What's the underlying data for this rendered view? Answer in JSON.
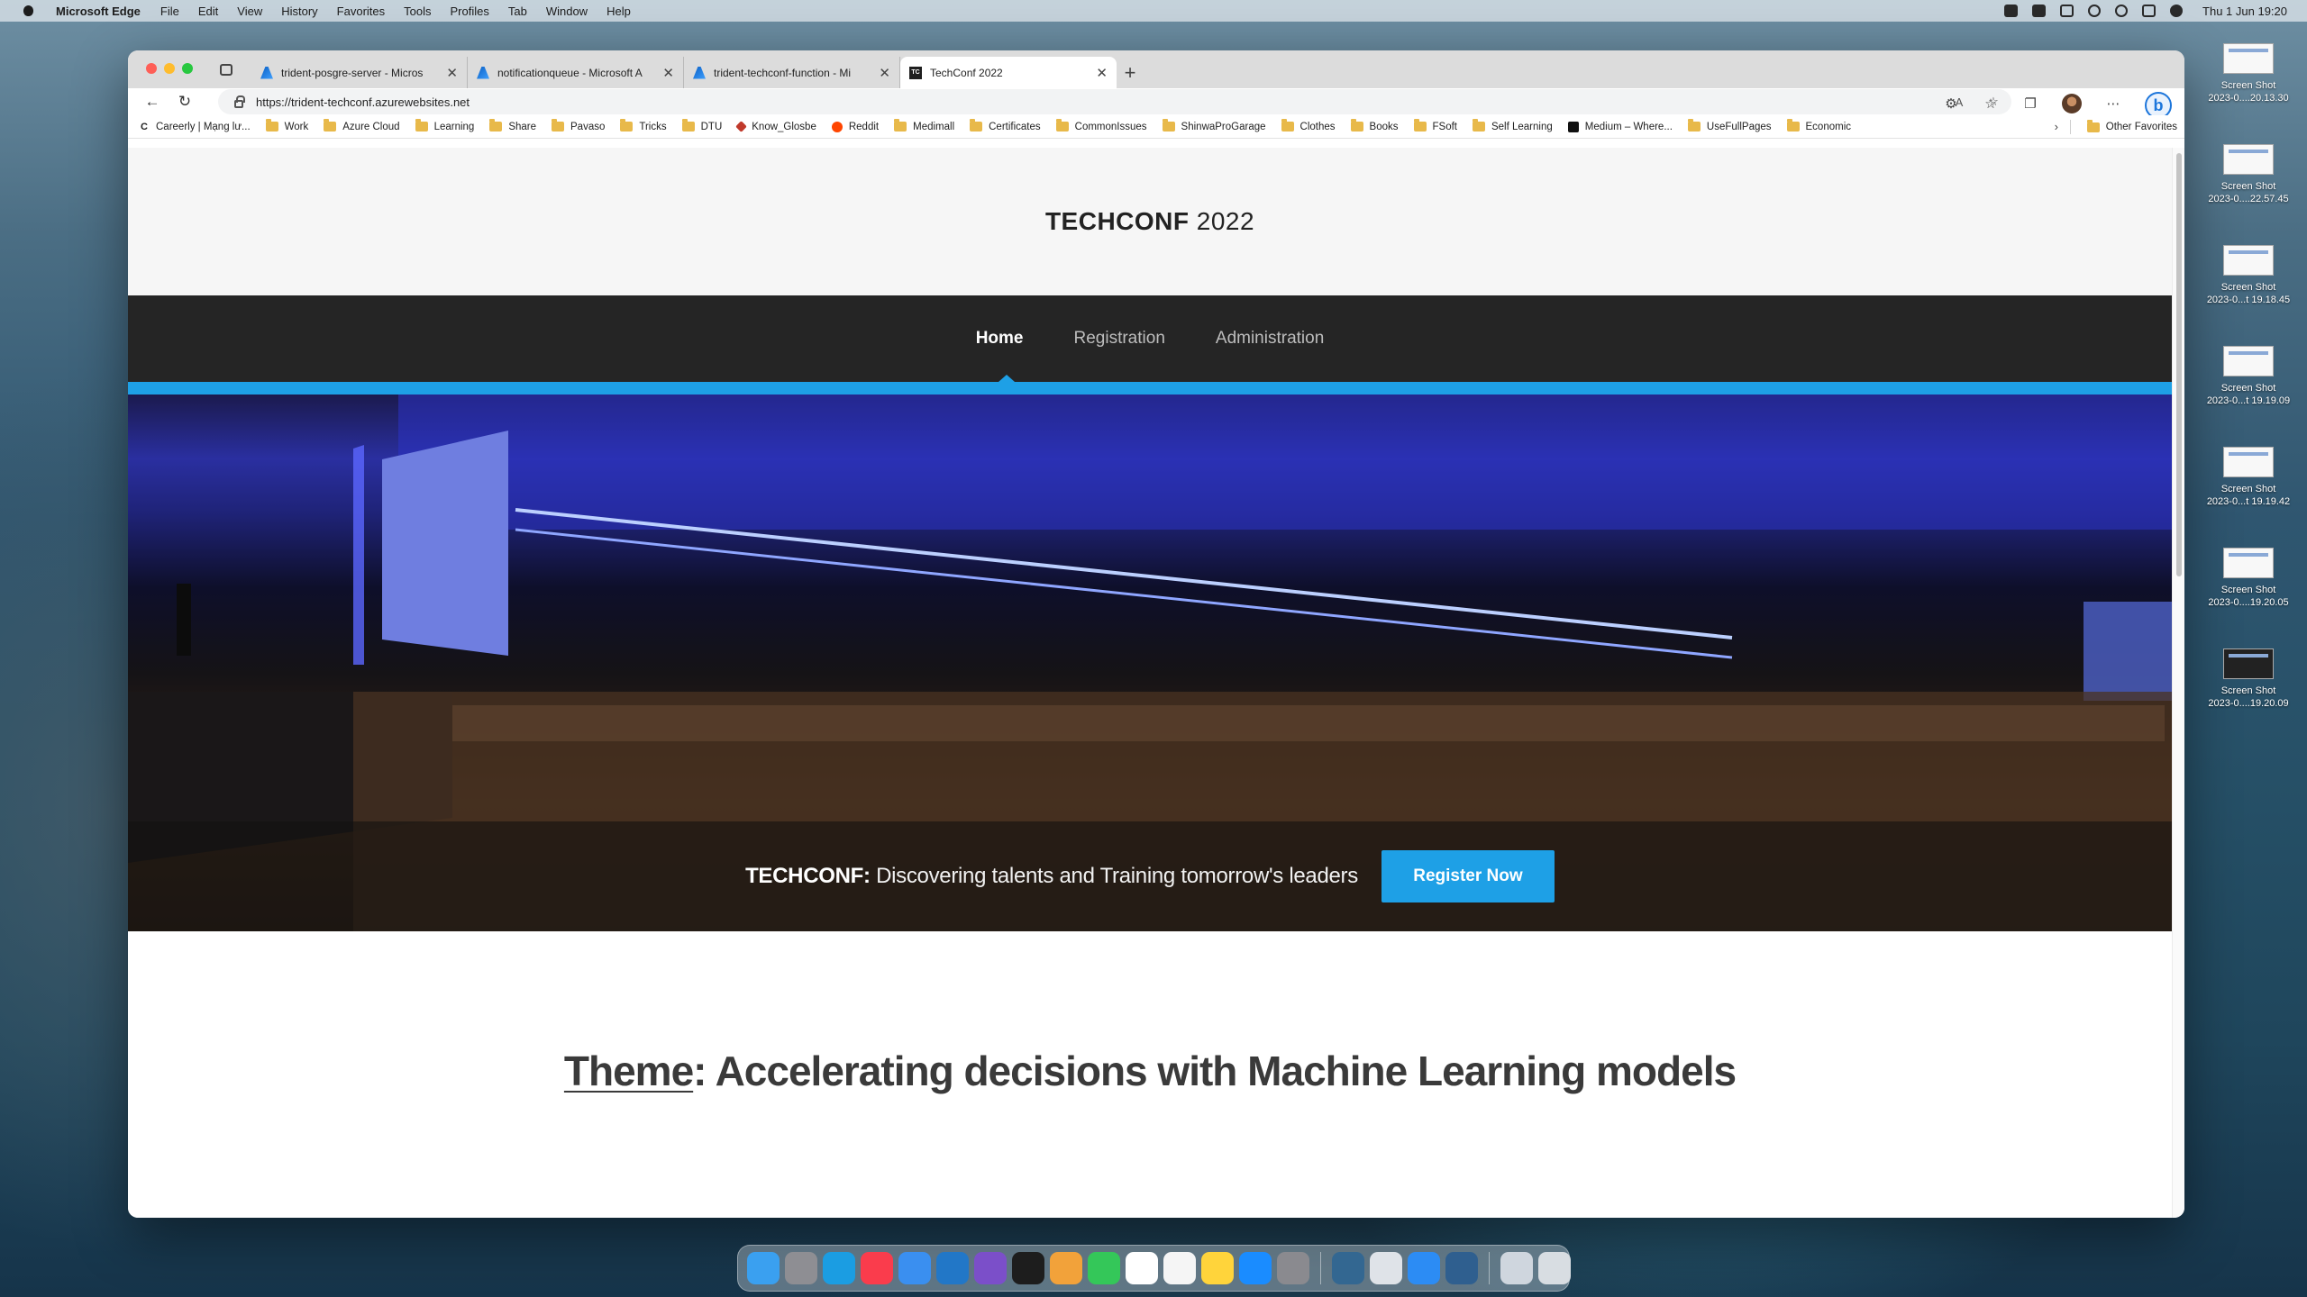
{
  "menubar": {
    "app_name": "Microsoft Edge",
    "menus": [
      "File",
      "Edit",
      "View",
      "History",
      "Favorites",
      "Tools",
      "Profiles",
      "Tab",
      "Window",
      "Help"
    ],
    "clock": "Thu 1 Jun  19:20"
  },
  "browser": {
    "tabs": [
      {
        "label": "trident-posgre-server - Micros",
        "favicon": "azure-icon"
      },
      {
        "label": "notificationqueue - Microsoft A",
        "favicon": "azure-icon"
      },
      {
        "label": "trident-techconf-function - Mi",
        "favicon": "azure-icon"
      },
      {
        "label": "TechConf 2022",
        "favicon": "tc-icon",
        "favicon_text": "TC",
        "active": true
      }
    ],
    "url": "https://trident-techconf.azurewebsites.net",
    "favorites": [
      {
        "label": "Careerly | Mạng lư...",
        "icon": "careerly-icon",
        "icon_text": "C"
      },
      {
        "label": "Work",
        "icon": "folder-icon"
      },
      {
        "label": "Azure Cloud",
        "icon": "folder-icon"
      },
      {
        "label": "Learning",
        "icon": "folder-icon"
      },
      {
        "label": "Share",
        "icon": "folder-icon"
      },
      {
        "label": "Pavaso",
        "icon": "folder-icon"
      },
      {
        "label": "Tricks",
        "icon": "folder-icon"
      },
      {
        "label": "DTU",
        "icon": "folder-icon"
      },
      {
        "label": "Know_Glosbe",
        "icon": "glosbe-icon"
      },
      {
        "label": "Reddit",
        "icon": "reddit-icon"
      },
      {
        "label": "Medimall",
        "icon": "folder-icon"
      },
      {
        "label": "Certificates",
        "icon": "folder-icon"
      },
      {
        "label": "CommonIssues",
        "icon": "folder-icon"
      },
      {
        "label": "ShinwaProGarage",
        "icon": "folder-icon"
      },
      {
        "label": "Clothes",
        "icon": "folder-icon"
      },
      {
        "label": "Books",
        "icon": "folder-icon"
      },
      {
        "label": "FSoft",
        "icon": "folder-icon"
      },
      {
        "label": "Self Learning",
        "icon": "folder-icon"
      },
      {
        "label": "Medium – Where...",
        "icon": "medium-icon"
      },
      {
        "label": "UseFullPages",
        "icon": "folder-icon"
      },
      {
        "label": "Economic",
        "icon": "folder-icon"
      }
    ],
    "other_favorites": "Other Favorites"
  },
  "site": {
    "brand_bold": "TECHCONF",
    "brand_light": "2022",
    "nav": [
      {
        "label": "Home",
        "active": true
      },
      {
        "label": "Registration",
        "active": false
      },
      {
        "label": "Administration",
        "active": false
      }
    ],
    "hero": {
      "tagline_bold": "TECHCONF:",
      "tagline": "Discovering talents and Training tomorrow's leaders",
      "cta": "Register Now"
    },
    "theme": {
      "prefix": "Theme",
      "text": ": Accelerating decisions with Machine Learning models"
    },
    "accent_color": "#1ea0e6",
    "nav_bg": "#252525"
  },
  "desktop": {
    "files": [
      {
        "line1": "Screen Shot",
        "line2": "2023-0....20.13.30"
      },
      {
        "line1": "Screen Shot",
        "line2": "2023-0....22.57.45"
      },
      {
        "line1": "Screen Shot",
        "line2": "2023-0...t 19.18.45"
      },
      {
        "line1": "Screen Shot",
        "line2": "2023-0...t 19.19.09"
      },
      {
        "line1": "Screen Shot",
        "line2": "2023-0...t 19.19.42"
      },
      {
        "line1": "Screen Shot",
        "line2": "2023-0....19.20.05"
      },
      {
        "line1": "Screen Shot",
        "line2": "2023-0....19.20.09"
      }
    ]
  },
  "dock": {
    "apps": [
      {
        "name": "finder-icon",
        "color": "#3aa0f0"
      },
      {
        "name": "launchpad-icon",
        "color": "#8e8e93"
      },
      {
        "name": "edge-icon",
        "color": "#1b9de2"
      },
      {
        "name": "music-icon",
        "color": "#fa3c4c"
      },
      {
        "name": "mail-icon",
        "color": "#3a8ff0"
      },
      {
        "name": "vscode-icon",
        "color": "#2277c7"
      },
      {
        "name": "visual-studio-icon",
        "color": "#7b4fc9"
      },
      {
        "name": "terminal-icon",
        "color": "#1d1d1d"
      },
      {
        "name": "photos-icon",
        "color": "#f2a23a"
      },
      {
        "name": "facetime-icon",
        "color": "#34c759"
      },
      {
        "name": "calendar-icon",
        "color": "#ffffff"
      },
      {
        "name": "reminders-icon",
        "color": "#f5f5f5"
      },
      {
        "name": "notes-icon",
        "color": "#ffd43b"
      },
      {
        "name": "app-store-icon",
        "color": "#1a8cff"
      },
      {
        "name": "system-settings-icon",
        "color": "#8a8a8f"
      },
      {
        "name": "postgres-icon",
        "color": "#336791"
      },
      {
        "name": "script-editor-icon",
        "color": "#dfe3e8"
      },
      {
        "name": "safari-icon",
        "color": "#2c8cf4"
      },
      {
        "name": "pgadmin-icon",
        "color": "#2f5f8f"
      },
      {
        "name": "downloads-icon",
        "color": "#cfd6de"
      },
      {
        "name": "trash-icon",
        "color": "#d8dde2"
      }
    ],
    "separator_after": [
      14,
      18
    ]
  }
}
